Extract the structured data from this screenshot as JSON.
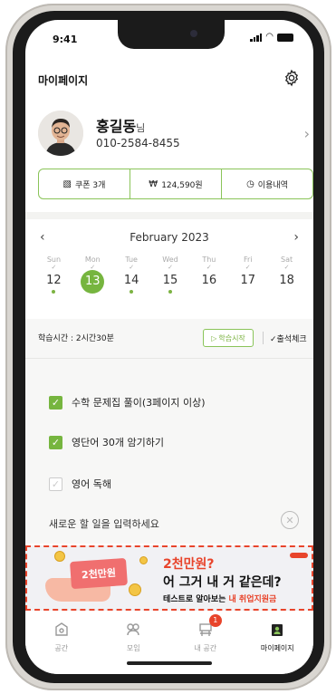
{
  "status": {
    "time": "9:41"
  },
  "header": {
    "title": "마이페이지"
  },
  "profile": {
    "name": "홍길동",
    "suffix": "님",
    "phone": "010-2584-8455"
  },
  "stats": [
    {
      "icon": "coupon-icon",
      "label": "쿠폰 3개"
    },
    {
      "icon": "won-icon",
      "label": "124,590원"
    },
    {
      "icon": "clock-icon",
      "label": "이용내역"
    }
  ],
  "calendar": {
    "month": "February 2023",
    "days": [
      {
        "name": "Sun",
        "num": "12",
        "checked": true,
        "dot": true
      },
      {
        "name": "Mon",
        "num": "13",
        "checked": true,
        "dot": true,
        "selected": true
      },
      {
        "name": "Tue",
        "num": "14",
        "checked": true,
        "dot": true
      },
      {
        "name": "Wed",
        "num": "15",
        "checked": true,
        "dot": true
      },
      {
        "name": "Thu",
        "num": "16",
        "checked": true,
        "dot": false
      },
      {
        "name": "Fri",
        "num": "17",
        "checked": true,
        "dot": false
      },
      {
        "name": "Sat",
        "num": "18",
        "checked": true,
        "dot": false
      }
    ]
  },
  "study": {
    "time_label": "학습시간 : 2시간30분",
    "start_label": "학습시작",
    "attendance_label": "출석체크",
    "todos": [
      {
        "text": "수학 문제집 풀이(3페이지 이상)",
        "done": true
      },
      {
        "text": "영단어 30개 암기하기",
        "done": true
      },
      {
        "text": "영어 독해",
        "done": false
      }
    ],
    "new_task_placeholder": "새로운 할 일을 입력하세요"
  },
  "banner": {
    "card_text": "2천만원",
    "line1": "2천만원?",
    "line2": "어 그거 내 거 같은데?",
    "line3_prefix": "테스트로 알아보는 ",
    "line3_highlight": "내 취업지원금"
  },
  "tabs": [
    {
      "label": "공간",
      "icon": "space-icon",
      "active": false
    },
    {
      "label": "모임",
      "icon": "group-icon",
      "active": false
    },
    {
      "label": "내 공간",
      "icon": "my-space-icon",
      "active": false,
      "badge": "1"
    },
    {
      "label": "마이페이지",
      "icon": "mypage-icon",
      "active": true
    }
  ],
  "colors": {
    "accent": "#76b53f",
    "banner_red": "#e8442b"
  }
}
